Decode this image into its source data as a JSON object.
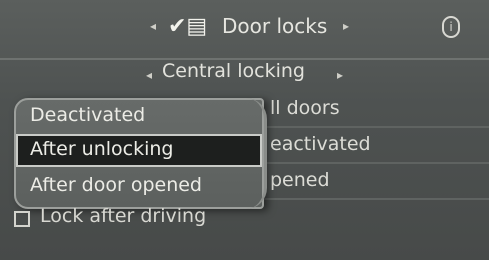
{
  "header": {
    "title": "Door locks",
    "vehicle_icon": "car-lock-check-icon",
    "info_icon": "info-icon",
    "left_arrow": "◂",
    "right_arrow": "▸"
  },
  "subheader": {
    "title": "Central locking",
    "left_arrow": "◂",
    "right_arrow": "▸"
  },
  "background_list": [
    {
      "label": "ll doors"
    },
    {
      "label": "eactivated"
    },
    {
      "label": "pened"
    }
  ],
  "popup": {
    "items": [
      {
        "label": "Deactivated",
        "selected": false
      },
      {
        "label": "After unlocking",
        "selected": true
      },
      {
        "label": "After door opened",
        "selected": false
      }
    ]
  },
  "lock_after_driving": {
    "label": "Lock after driving",
    "checked": false
  }
}
